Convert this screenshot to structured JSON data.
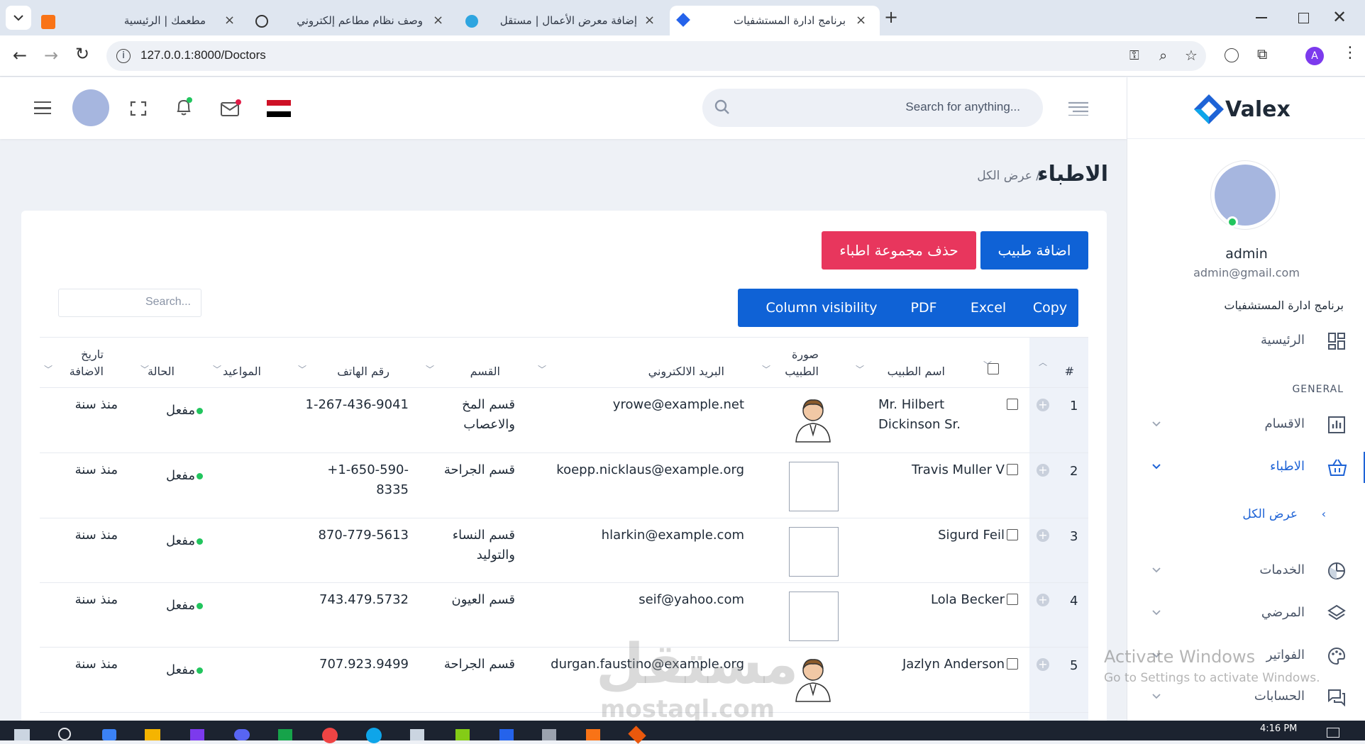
{
  "browser": {
    "tabs": [
      {
        "title": "مطعمك | الرئيسية"
      },
      {
        "title": "وصف نظام مطاعم إلكتروني"
      },
      {
        "title": "إضافة معرض الأعمال | مستقل"
      },
      {
        "title": "برنامج ادارة المستشفيات",
        "active": true
      }
    ],
    "url": "127.0.0.1:8000/Doctors",
    "profile_initial": "A"
  },
  "sidebar": {
    "brand": "Valex",
    "user_name": "admin",
    "user_email": "admin@gmail.com",
    "app_name": "برنامج ادارة المستشفيات",
    "section_general": "GENERAL",
    "items": [
      {
        "label": "الرئيسية",
        "icon": "dashboard-icon"
      },
      {
        "label": "الاقسام",
        "icon": "bar-chart-icon"
      },
      {
        "label": "الاطباء",
        "icon": "basket-icon",
        "active": true
      },
      {
        "label": "عرض الكل",
        "sub": true
      },
      {
        "label": "الخدمات",
        "icon": "pie-chart-icon"
      },
      {
        "label": "المرضي",
        "icon": "layers-icon"
      },
      {
        "label": "الفواتير",
        "icon": "palette-icon"
      },
      {
        "label": "الحسابات",
        "icon": "chat-icon"
      }
    ]
  },
  "header": {
    "search_placeholder": "Search for anything..."
  },
  "page": {
    "title": "الاطباء",
    "breadcrumb": "/ عرض الكل",
    "add_button": "اضافة طبيب",
    "delete_button": "حذف مجموعة اطباء",
    "export_buttons": [
      "Copy",
      "Excel",
      "PDF",
      "Column visibility"
    ],
    "table_search_placeholder": "Search..."
  },
  "table": {
    "headers": {
      "num": "#",
      "name": "اسم الطبيب",
      "photo": "صورة الطبيب",
      "email": "البريد الالكتروني",
      "dept": "القسم",
      "phone": "رقم الهاتف",
      "appointments": "المواعيد",
      "status": "الحالة",
      "added": "تاريخ الاضافة"
    },
    "rows": [
      {
        "num": "1",
        "name": "Mr. Hilbert Dickinson Sr.",
        "photo": "avatar",
        "email": "yrowe@example.net",
        "dept": "قسم المخ والاعصاب",
        "phone": "1-267-436-9041",
        "status": "مفعل",
        "added": "منذ سنة"
      },
      {
        "num": "2",
        "name": "Travis Muller V",
        "photo": "broken",
        "email": "koepp.nicklaus@example.org",
        "dept": "قسم الجراحة",
        "phone": "+1-650-590-8335",
        "status": "مفعل",
        "added": "منذ سنة"
      },
      {
        "num": "3",
        "name": "Sigurd Feil",
        "photo": "broken",
        "email": "hlarkin@example.com",
        "dept": "قسم النساء والتوليد",
        "phone": "870-779-5613",
        "status": "مفعل",
        "added": "منذ سنة"
      },
      {
        "num": "4",
        "name": "Lola Becker",
        "photo": "broken",
        "email": "seif@yahoo.com",
        "dept": "قسم العيون",
        "phone": "743.479.5732",
        "status": "مفعل",
        "added": "منذ سنة"
      },
      {
        "num": "5",
        "name": "Jazlyn Anderson",
        "photo": "avatar",
        "email": "durgan.faustino@example.org",
        "dept": "قسم الجراحة",
        "phone": "707.923.9499",
        "status": "مفعل",
        "added": "منذ سنة"
      }
    ]
  },
  "overlay": {
    "activate_title": "Activate Windows",
    "activate_sub": "Go to Settings to activate Windows.",
    "watermark_ar": "مستقل",
    "watermark_en": "mostaql.com"
  },
  "taskbar": {
    "time": "4:16 PM"
  },
  "colors": {
    "primary": "#0f62d6",
    "danger": "#e8365d",
    "status_green": "#22c55e"
  }
}
